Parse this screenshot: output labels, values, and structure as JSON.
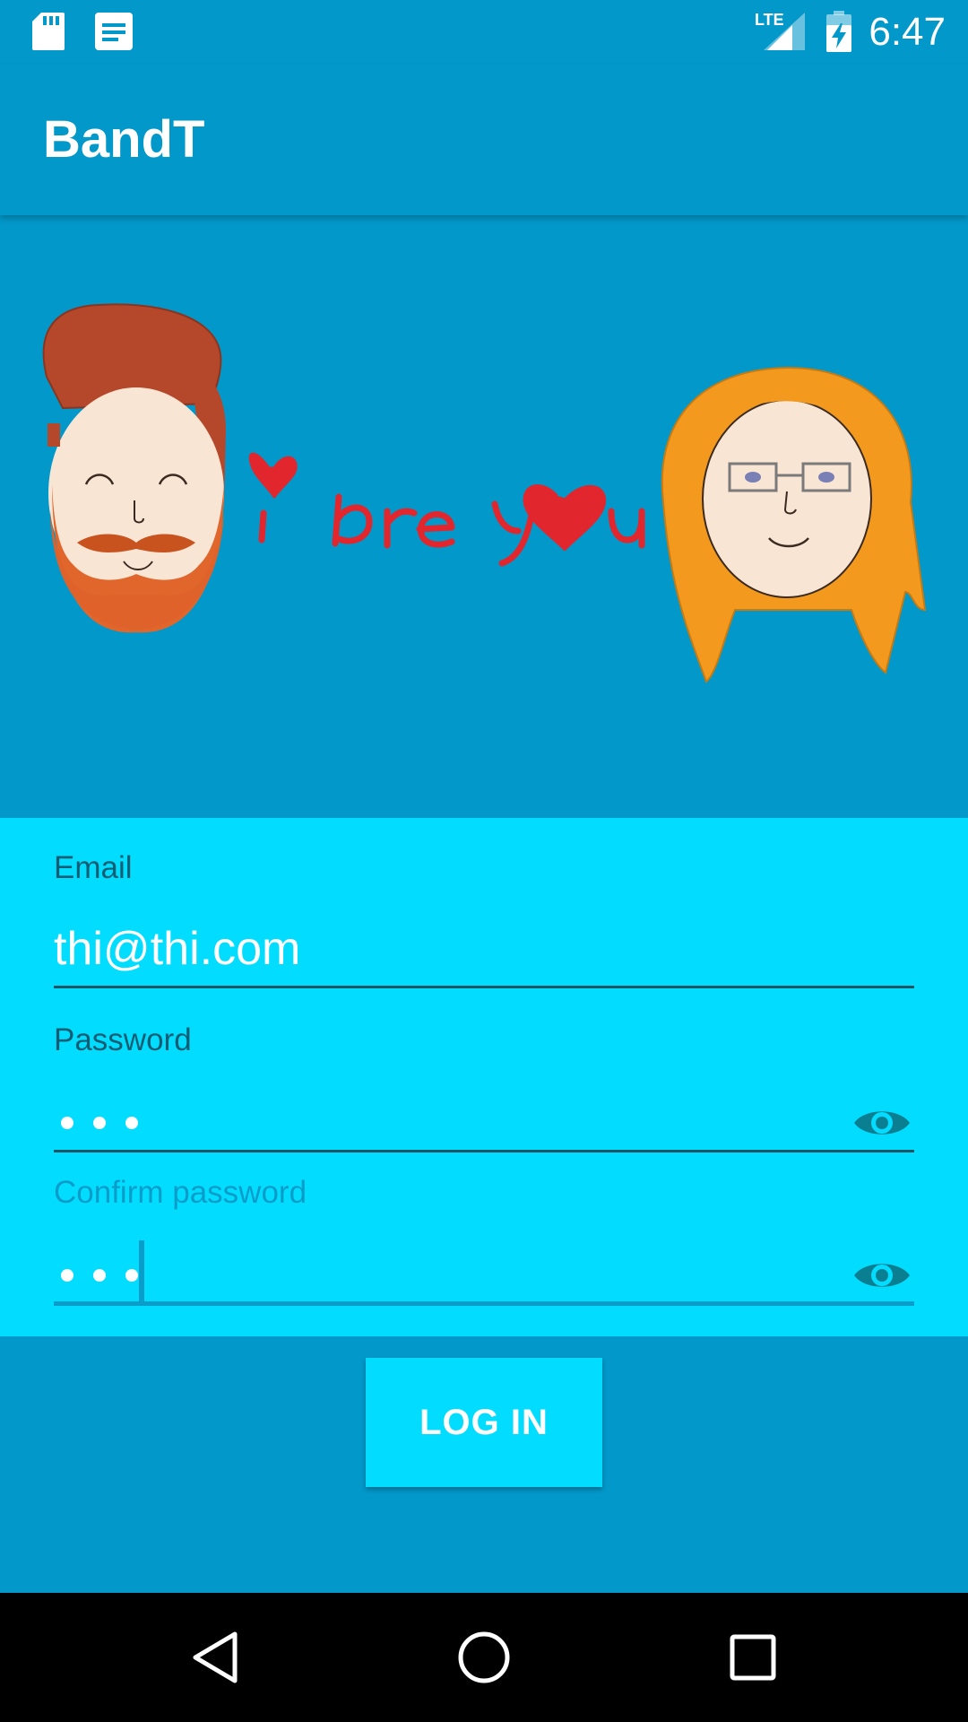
{
  "status_bar": {
    "time": "6:47",
    "network": "LTE",
    "left_icons": [
      "sd-card-icon",
      "notes-icon"
    ]
  },
  "app_bar": {
    "title": "BandT"
  },
  "hero": {
    "caption": "i bre you"
  },
  "form": {
    "email": {
      "label": "Email",
      "value": "thi@thi.com"
    },
    "password": {
      "label": "Password",
      "masked_length": 3,
      "toggle_icon": "eye-icon"
    },
    "confirm_password": {
      "label": "Confirm password",
      "masked_length": 3,
      "focused": true,
      "toggle_icon": "eye-icon"
    }
  },
  "login_button": {
    "label": "LOG IN"
  },
  "nav_bar": {
    "buttons": [
      "back-icon",
      "home-icon",
      "recents-icon"
    ]
  },
  "colors": {
    "primary": "#0398CA",
    "accent": "#02DDFF",
    "text_on_primary": "#FFFFFF",
    "label": "#0D5E74",
    "focused": "#0A9DC9",
    "nav_bar": "#000000"
  }
}
